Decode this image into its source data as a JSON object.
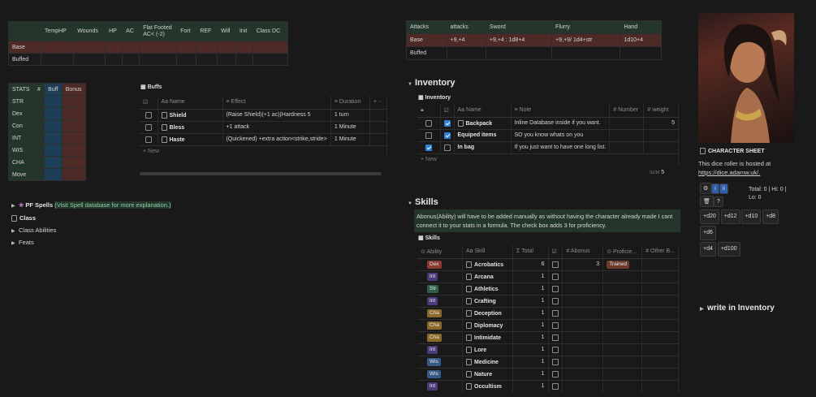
{
  "stats_table": {
    "headers": [
      "",
      "TempHP",
      "Wounds",
      "HP",
      "AC",
      "Flat Footed AC< (-2)",
      "Fort",
      "REF",
      "Will",
      "Init",
      "Class DC"
    ],
    "rows": [
      {
        "label": "Base"
      },
      {
        "label": "Buffed"
      }
    ]
  },
  "attacks_table": {
    "headers": [
      "Attacks",
      "attacks",
      "Sword",
      "Flurry",
      "Hand"
    ],
    "base": [
      "Base",
      "+9,+4",
      "+9,+4 : 1d8+4",
      "+9,+9/ 1d4+str",
      "1d10+4"
    ],
    "buffed": [
      "Buffed",
      "",
      "",
      "",
      ""
    ]
  },
  "ability_table": {
    "headers": [
      "STATS",
      "#",
      "Buff",
      "Bonus"
    ],
    "rows": [
      "STR",
      "Dex",
      "Con",
      "INT",
      "WIS",
      "CHA",
      "Move"
    ]
  },
  "buffs": {
    "title": "Buffs",
    "cols": [
      "Name",
      "Effect",
      "Duration"
    ],
    "rows": [
      {
        "name": "Shield",
        "effect": "(Raise Shield)(+1 ac)(Hardness 5",
        "duration": "1 turn"
      },
      {
        "name": "Bless",
        "effect": "+1 attack",
        "duration": "1 Minute"
      },
      {
        "name": "Haste",
        "effect": "(Quickened) +extra action<strike,stride>",
        "duration": "1 Minute"
      }
    ],
    "new": "New"
  },
  "left_links": {
    "spells_name": "PF Spells",
    "spells_note": "(Visit Spell database for more explanation.)",
    "class": "Class",
    "class_abilities": "Class Abilities",
    "feats": "Feats"
  },
  "inventory": {
    "heading": "Inventory",
    "db_title": "Inventory",
    "cols": [
      "Name",
      "Note",
      "Number",
      "weight"
    ],
    "rows": [
      {
        "checked1": false,
        "checked2": true,
        "name": "Backpack",
        "note": "Inline Database inside if you want.",
        "number": "",
        "weight": "5"
      },
      {
        "checked1": false,
        "checked2": true,
        "name": "Equiped items",
        "note": "SO you know whats on you",
        "number": "",
        "weight": ""
      },
      {
        "checked1": true,
        "checked2": false,
        "name": "In bag",
        "note": "If you just want to have one long list.",
        "number": "",
        "weight": ""
      }
    ],
    "new": "New",
    "sum_label": "SUM",
    "sum_value": "5"
  },
  "skills": {
    "heading": "Skills",
    "callout": "Abonus(Ability) will have to be added manually as without having the character already made I cant connect it to your stats in a formula. The check box adds 3 for proficiency.",
    "db_title": "Skills",
    "cols": [
      "Ability",
      "Skill",
      "Total",
      "",
      "Abonus",
      "Proficie...",
      "Other B..."
    ],
    "rows": [
      {
        "ability": "Dex",
        "cls": "t-dex",
        "skill": "Acrobatics",
        "total": "6",
        "abonus": "3",
        "prof": "Trained"
      },
      {
        "ability": "Int",
        "cls": "t-int",
        "skill": "Arcana",
        "total": "1",
        "abonus": "",
        "prof": ""
      },
      {
        "ability": "Str",
        "cls": "t-str",
        "skill": "Athletics",
        "total": "1",
        "abonus": "",
        "prof": ""
      },
      {
        "ability": "Int",
        "cls": "t-int",
        "skill": "Crafting",
        "total": "1",
        "abonus": "",
        "prof": ""
      },
      {
        "ability": "Cha",
        "cls": "t-cha",
        "skill": "Deception",
        "total": "1",
        "abonus": "",
        "prof": ""
      },
      {
        "ability": "Cha",
        "cls": "t-cha",
        "skill": "Diplomacy",
        "total": "1",
        "abonus": "",
        "prof": ""
      },
      {
        "ability": "Cha",
        "cls": "t-cha",
        "skill": "Intimidate",
        "total": "1",
        "abonus": "",
        "prof": ""
      },
      {
        "ability": "Int",
        "cls": "t-int",
        "skill": "Lore",
        "total": "1",
        "abonus": "",
        "prof": ""
      },
      {
        "ability": "Wis",
        "cls": "t-wis",
        "skill": "Medicine",
        "total": "1",
        "abonus": "",
        "prof": ""
      },
      {
        "ability": "Wis",
        "cls": "t-wis",
        "skill": "Nature",
        "total": "1",
        "abonus": "",
        "prof": ""
      },
      {
        "ability": "Int",
        "cls": "t-int",
        "skill": "Occultism",
        "total": "1",
        "abonus": "",
        "prof": ""
      }
    ]
  },
  "sidebar": {
    "title": "CHARACTER SHEET",
    "text": "This dice roller is hosted at",
    "url": "https://dice.adamw.uk/.",
    "total": "Total: 0 | Hi: 0 |",
    "lo": "Lo: 0",
    "dice": [
      "+d20",
      "+d12",
      "+d10",
      "+d8",
      "+d6",
      "+d4",
      "+d100"
    ],
    "write_inventory": "write in Inventory"
  }
}
